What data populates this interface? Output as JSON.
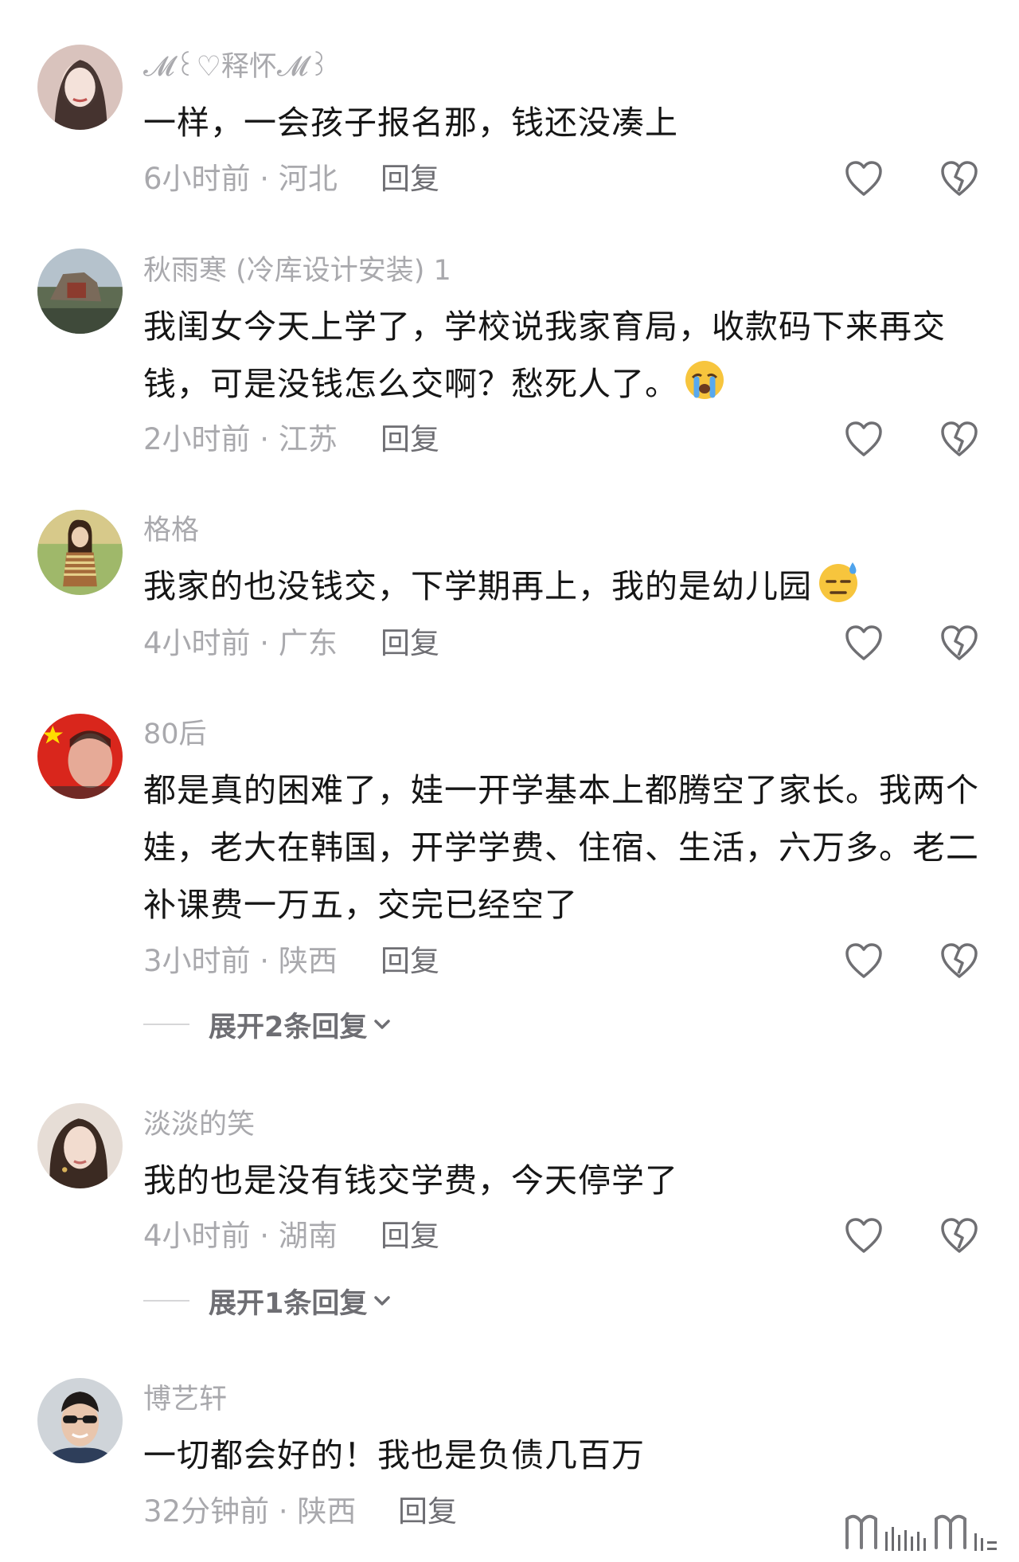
{
  "comments": [
    {
      "username": "𝓜꒰♡释怀𝓜꒱",
      "text": "一样，一会孩子报名那，钱还没凑上",
      "time_location": "6小时前 · 河北",
      "reply_label": "回复"
    },
    {
      "username": "秋雨寒 (冷库设计安装) 1",
      "text": "我闺女今天上学了，学校说我家育局，收款码下来再交钱，可是没钱怎么交啊？愁死人了。",
      "emoji": "crying-face",
      "time_location": "2小时前 · 江苏",
      "reply_label": "回复"
    },
    {
      "username": "格格",
      "text": "我家的也没钱交，下学期再上，我的是幼儿园",
      "emoji": "sweat-face",
      "time_location": "4小时前 · 广东",
      "reply_label": "回复"
    },
    {
      "username": "80后",
      "text": "都是真的困难了，娃一开学基本上都腾空了家长。我两个娃，老大在韩国，开学学费、住宿、生活，六万多。老二补课费一万五，交完已经空了",
      "time_location": "3小时前 · 陕西",
      "reply_label": "回复",
      "expand_label": "展开2条回复"
    },
    {
      "username": "淡淡的笑",
      "text": "我的也是没有钱交学费，今天停学了",
      "time_location": "4小时前 · 湖南",
      "reply_label": "回复",
      "expand_label": "展开1条回复"
    },
    {
      "username": "博艺轩",
      "text": "一切都会好的！我也是负债几百万",
      "time_location": "32分钟前 · 陕西",
      "reply_label": "回复"
    }
  ],
  "icons": {
    "like": "heart-outline-icon",
    "dislike": "broken-heart-outline-icon",
    "expand": "chevron-down-icon"
  },
  "colors": {
    "text": "#161616",
    "secondary": "#a9a9ad",
    "reply": "#6e6e73"
  }
}
